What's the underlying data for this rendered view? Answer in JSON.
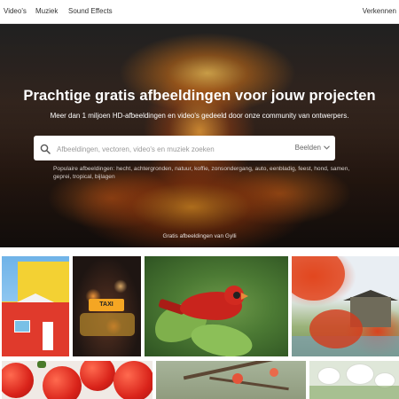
{
  "nav": {
    "links": [
      "Video's",
      "Muziek",
      "Sound Effects"
    ],
    "explore": "Verkennen"
  },
  "hero": {
    "title": "Prachtige gratis afbeeldingen voor jouw projecten",
    "subtitle": "Meer dan 1 miljoen HD-afbeeldingen en video's gedeeld door onze community van ontwerpers.",
    "search": {
      "placeholder": "Afbeeldingen, vectoren, video's en muziek zoeken",
      "value": "",
      "type_label": "Beelden"
    },
    "popular": "Populaire afbeeldingen: hecht, achtergronden, natuur, koffie, zonsondergang, auto, eenbladig, feest, hond, samen, geprei, tropical, bijlagen",
    "credit": "Gratis afbeeldingen van Gylli"
  },
  "gallery": {
    "tiles": [
      {
        "name": "yellow-red-houses"
      },
      {
        "name": "taxi-at-night"
      },
      {
        "name": "northern-cardinal"
      },
      {
        "name": "autumn-pavilion"
      },
      {
        "name": "tomatoes"
      },
      {
        "name": "blossom-branches"
      },
      {
        "name": "white-flowers"
      }
    ],
    "taxi_sign": "TAXI"
  },
  "colors": {
    "hero_text": "#ffffff",
    "nav_text": "#333333",
    "cardinal_red": "#c9241d",
    "lava_orange": "#ff8c1e"
  },
  "icons": {
    "search": "search-icon",
    "chevron": "chevron-down-icon"
  }
}
